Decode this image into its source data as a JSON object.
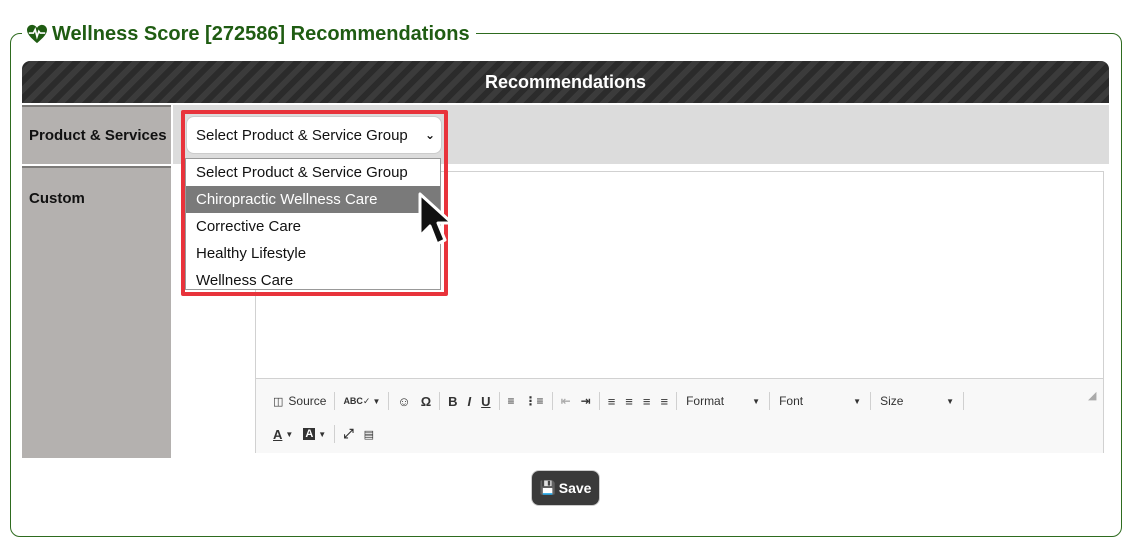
{
  "legend": {
    "title": "Wellness Score [272586] Recommendations",
    "icon": "heartbeat-icon",
    "color": "#1f5c12"
  },
  "table": {
    "header": "Recommendations",
    "row_product_label": "Product & Services",
    "row_custom_label": "Custom"
  },
  "select": {
    "selected_value": "Select Product & Service Group",
    "options": [
      "Select Product & Service Group",
      "Chiropractic Wellness Care",
      "Corrective Care",
      "Healthy Lifestyle",
      "Wellness Care"
    ],
    "highlighted_index": 1
  },
  "toolbar": {
    "source_label": "Source",
    "format_label": "Format",
    "font_label": "Font",
    "size_label": "Size"
  },
  "save_label": "Save",
  "colors": {
    "highlight": "#e8333b",
    "header_bg": "#2b2b2b",
    "label_bg": "#b4b1af"
  }
}
